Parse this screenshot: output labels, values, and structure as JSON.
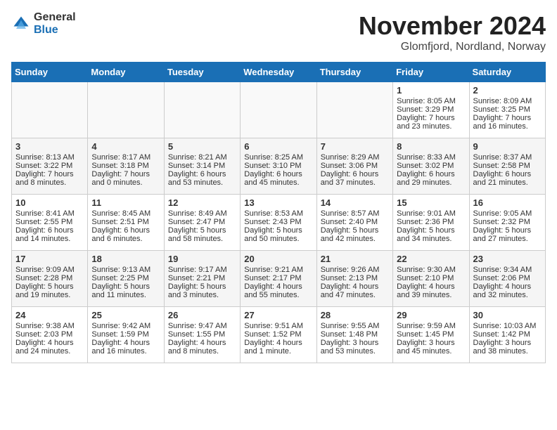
{
  "header": {
    "logo_general": "General",
    "logo_blue": "Blue",
    "month_title": "November 2024",
    "location": "Glomfjord, Nordland, Norway"
  },
  "days_of_week": [
    "Sunday",
    "Monday",
    "Tuesday",
    "Wednesday",
    "Thursday",
    "Friday",
    "Saturday"
  ],
  "weeks": [
    [
      {
        "day": "",
        "content": ""
      },
      {
        "day": "",
        "content": ""
      },
      {
        "day": "",
        "content": ""
      },
      {
        "day": "",
        "content": ""
      },
      {
        "day": "",
        "content": ""
      },
      {
        "day": "1",
        "content": "Sunrise: 8:05 AM\nSunset: 3:29 PM\nDaylight: 7 hours\nand 23 minutes."
      },
      {
        "day": "2",
        "content": "Sunrise: 8:09 AM\nSunset: 3:25 PM\nDaylight: 7 hours\nand 16 minutes."
      }
    ],
    [
      {
        "day": "3",
        "content": "Sunrise: 8:13 AM\nSunset: 3:22 PM\nDaylight: 7 hours\nand 8 minutes."
      },
      {
        "day": "4",
        "content": "Sunrise: 8:17 AM\nSunset: 3:18 PM\nDaylight: 7 hours\nand 0 minutes."
      },
      {
        "day": "5",
        "content": "Sunrise: 8:21 AM\nSunset: 3:14 PM\nDaylight: 6 hours\nand 53 minutes."
      },
      {
        "day": "6",
        "content": "Sunrise: 8:25 AM\nSunset: 3:10 PM\nDaylight: 6 hours\nand 45 minutes."
      },
      {
        "day": "7",
        "content": "Sunrise: 8:29 AM\nSunset: 3:06 PM\nDaylight: 6 hours\nand 37 minutes."
      },
      {
        "day": "8",
        "content": "Sunrise: 8:33 AM\nSunset: 3:02 PM\nDaylight: 6 hours\nand 29 minutes."
      },
      {
        "day": "9",
        "content": "Sunrise: 8:37 AM\nSunset: 2:58 PM\nDaylight: 6 hours\nand 21 minutes."
      }
    ],
    [
      {
        "day": "10",
        "content": "Sunrise: 8:41 AM\nSunset: 2:55 PM\nDaylight: 6 hours\nand 14 minutes."
      },
      {
        "day": "11",
        "content": "Sunrise: 8:45 AM\nSunset: 2:51 PM\nDaylight: 6 hours\nand 6 minutes."
      },
      {
        "day": "12",
        "content": "Sunrise: 8:49 AM\nSunset: 2:47 PM\nDaylight: 5 hours\nand 58 minutes."
      },
      {
        "day": "13",
        "content": "Sunrise: 8:53 AM\nSunset: 2:43 PM\nDaylight: 5 hours\nand 50 minutes."
      },
      {
        "day": "14",
        "content": "Sunrise: 8:57 AM\nSunset: 2:40 PM\nDaylight: 5 hours\nand 42 minutes."
      },
      {
        "day": "15",
        "content": "Sunrise: 9:01 AM\nSunset: 2:36 PM\nDaylight: 5 hours\nand 34 minutes."
      },
      {
        "day": "16",
        "content": "Sunrise: 9:05 AM\nSunset: 2:32 PM\nDaylight: 5 hours\nand 27 minutes."
      }
    ],
    [
      {
        "day": "17",
        "content": "Sunrise: 9:09 AM\nSunset: 2:28 PM\nDaylight: 5 hours\nand 19 minutes."
      },
      {
        "day": "18",
        "content": "Sunrise: 9:13 AM\nSunset: 2:25 PM\nDaylight: 5 hours\nand 11 minutes."
      },
      {
        "day": "19",
        "content": "Sunrise: 9:17 AM\nSunset: 2:21 PM\nDaylight: 5 hours\nand 3 minutes."
      },
      {
        "day": "20",
        "content": "Sunrise: 9:21 AM\nSunset: 2:17 PM\nDaylight: 4 hours\nand 55 minutes."
      },
      {
        "day": "21",
        "content": "Sunrise: 9:26 AM\nSunset: 2:13 PM\nDaylight: 4 hours\nand 47 minutes."
      },
      {
        "day": "22",
        "content": "Sunrise: 9:30 AM\nSunset: 2:10 PM\nDaylight: 4 hours\nand 39 minutes."
      },
      {
        "day": "23",
        "content": "Sunrise: 9:34 AM\nSunset: 2:06 PM\nDaylight: 4 hours\nand 32 minutes."
      }
    ],
    [
      {
        "day": "24",
        "content": "Sunrise: 9:38 AM\nSunset: 2:03 PM\nDaylight: 4 hours\nand 24 minutes."
      },
      {
        "day": "25",
        "content": "Sunrise: 9:42 AM\nSunset: 1:59 PM\nDaylight: 4 hours\nand 16 minutes."
      },
      {
        "day": "26",
        "content": "Sunrise: 9:47 AM\nSunset: 1:55 PM\nDaylight: 4 hours\nand 8 minutes."
      },
      {
        "day": "27",
        "content": "Sunrise: 9:51 AM\nSunset: 1:52 PM\nDaylight: 4 hours\nand 1 minute."
      },
      {
        "day": "28",
        "content": "Sunrise: 9:55 AM\nSunset: 1:48 PM\nDaylight: 3 hours\nand 53 minutes."
      },
      {
        "day": "29",
        "content": "Sunrise: 9:59 AM\nSunset: 1:45 PM\nDaylight: 3 hours\nand 45 minutes."
      },
      {
        "day": "30",
        "content": "Sunrise: 10:03 AM\nSunset: 1:42 PM\nDaylight: 3 hours\nand 38 minutes."
      }
    ]
  ]
}
